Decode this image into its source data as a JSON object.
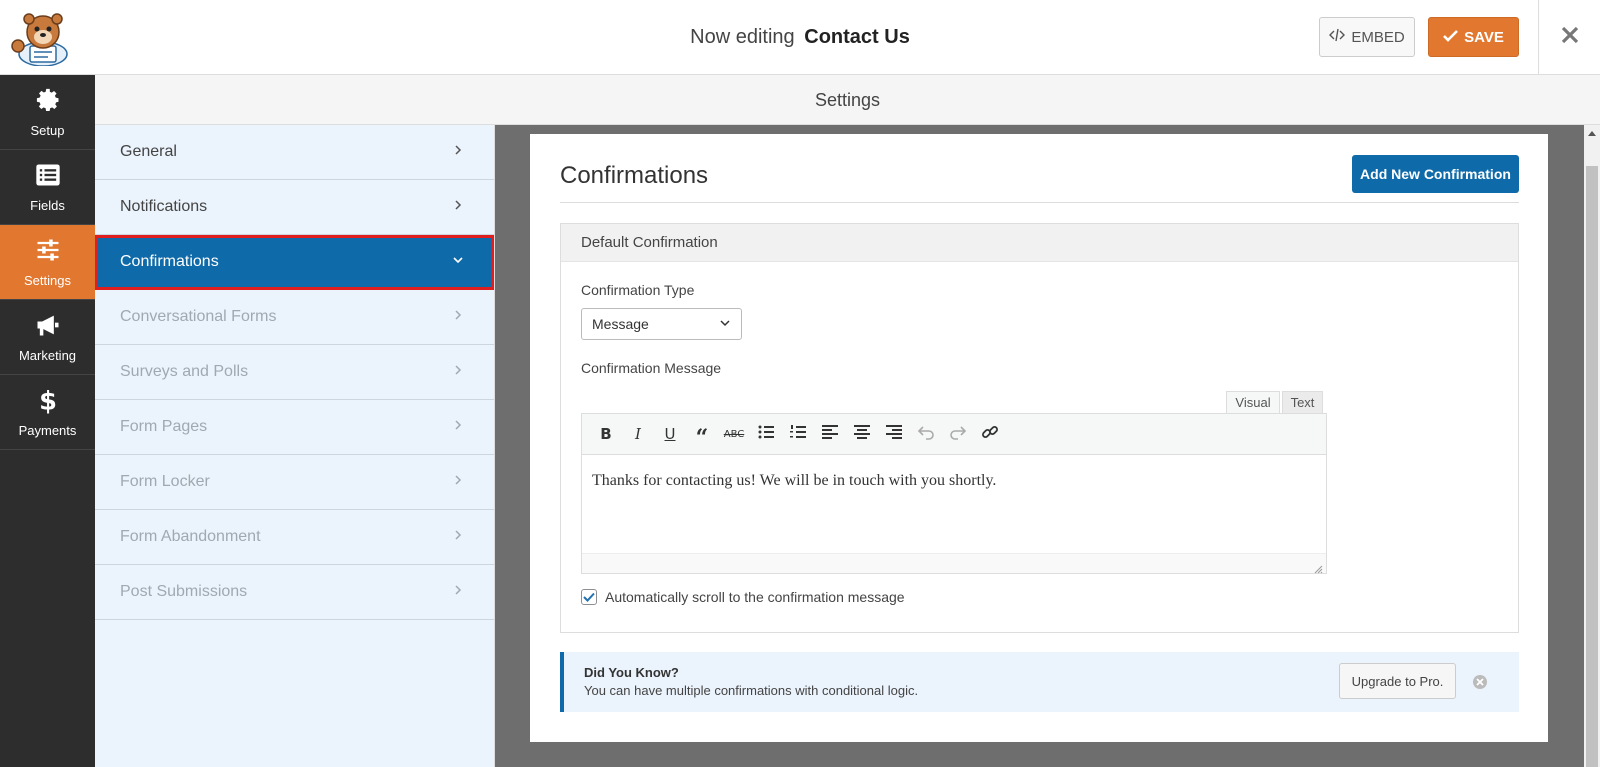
{
  "header": {
    "title_prefix": "Now editing",
    "form_name": "Contact Us",
    "embed_label": "EMBED",
    "save_label": "SAVE"
  },
  "left_nav": {
    "items": [
      {
        "label": "Setup",
        "icon": "gear-icon"
      },
      {
        "label": "Fields",
        "icon": "list-icon"
      },
      {
        "label": "Settings",
        "icon": "sliders-icon",
        "active": true
      },
      {
        "label": "Marketing",
        "icon": "megaphone-icon"
      },
      {
        "label": "Payments",
        "icon": "dollar-icon"
      }
    ]
  },
  "settings": {
    "header": "Settings",
    "sections": [
      {
        "label": "General",
        "state": "normal"
      },
      {
        "label": "Notifications",
        "state": "normal"
      },
      {
        "label": "Confirmations",
        "state": "active"
      },
      {
        "label": "Conversational Forms",
        "state": "disabled"
      },
      {
        "label": "Surveys and Polls",
        "state": "disabled"
      },
      {
        "label": "Form Pages",
        "state": "disabled"
      },
      {
        "label": "Form Locker",
        "state": "disabled"
      },
      {
        "label": "Form Abandonment",
        "state": "disabled"
      },
      {
        "label": "Post Submissions",
        "state": "disabled"
      }
    ]
  },
  "confirmations": {
    "title": "Confirmations",
    "add_button": "Add New Confirmation",
    "box_title": "Default Confirmation",
    "type_label": "Confirmation Type",
    "type_value": "Message",
    "message_label": "Confirmation Message",
    "tab_visual": "Visual",
    "tab_text": "Text",
    "message": "Thanks for contacting us! We will be in touch with you shortly.",
    "scroll_label": "Automatically scroll to the confirmation message",
    "scroll_checked": true
  },
  "did_you_know": {
    "title": "Did You Know?",
    "text": "You can have multiple confirmations with conditional logic.",
    "button": "Upgrade to Pro."
  },
  "colors": {
    "accent_orange": "#e27730",
    "primary_blue": "#0e6aa8",
    "highlight_red": "#e01e1e"
  }
}
